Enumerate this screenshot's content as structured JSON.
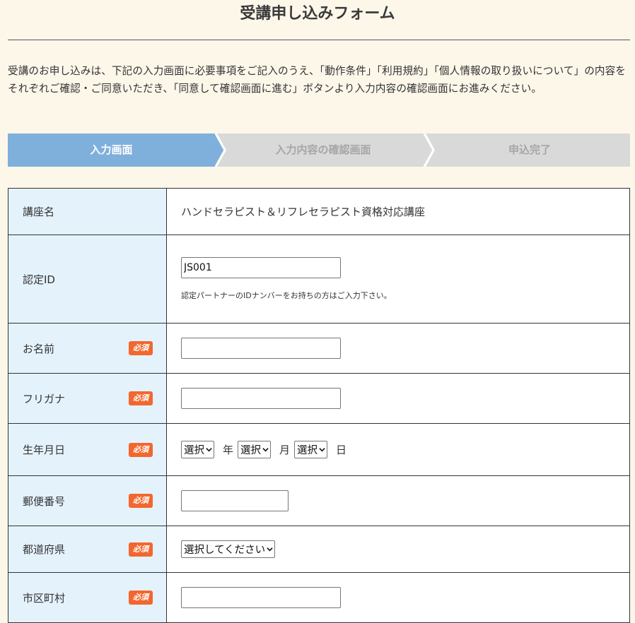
{
  "page": {
    "title": "受講申し込みフォーム",
    "intro": "受講のお申し込みは、下記の入力画面に必要事項をご記入のうえ、「動作条件」「利用規約」「個人情報の取り扱いについて」の内容をそれぞれご確認・ご同意いただき、「同意して確認画面に進む」ボタンより入力内容の確認画面にお進みください。"
  },
  "steps": [
    {
      "label": "入力画面",
      "active": true
    },
    {
      "label": "入力内容の確認画面",
      "active": false
    },
    {
      "label": "申込完了",
      "active": false
    }
  ],
  "colors": {
    "step_active": "#7fb0dc",
    "step_inactive": "#d9d9d9",
    "required_badge": "#f2672e",
    "label_bg": "#e4f2fc",
    "page_bg": "#fdf7ea"
  },
  "required_label": "必須",
  "form": {
    "course": {
      "label": "講座名",
      "value": "ハンドセラピスト＆リフレセラピスト資格対応講座"
    },
    "cert_id": {
      "label": "認定ID",
      "value": "JS001",
      "note": "認定パートナーのIDナンバーをお持ちの方はご入力下さい。"
    },
    "name": {
      "label": "お名前",
      "value": ""
    },
    "furigana": {
      "label": "フリガナ",
      "value": ""
    },
    "birthdate": {
      "label": "生年月日",
      "year_selected": "選択",
      "month_selected": "選択",
      "day_selected": "選択",
      "year_unit": "年",
      "month_unit": "月",
      "day_unit": "日"
    },
    "postal": {
      "label": "郵便番号",
      "value": ""
    },
    "prefecture": {
      "label": "都道府県",
      "selected": "選択してください"
    },
    "city": {
      "label": "市区町村",
      "value": ""
    }
  }
}
